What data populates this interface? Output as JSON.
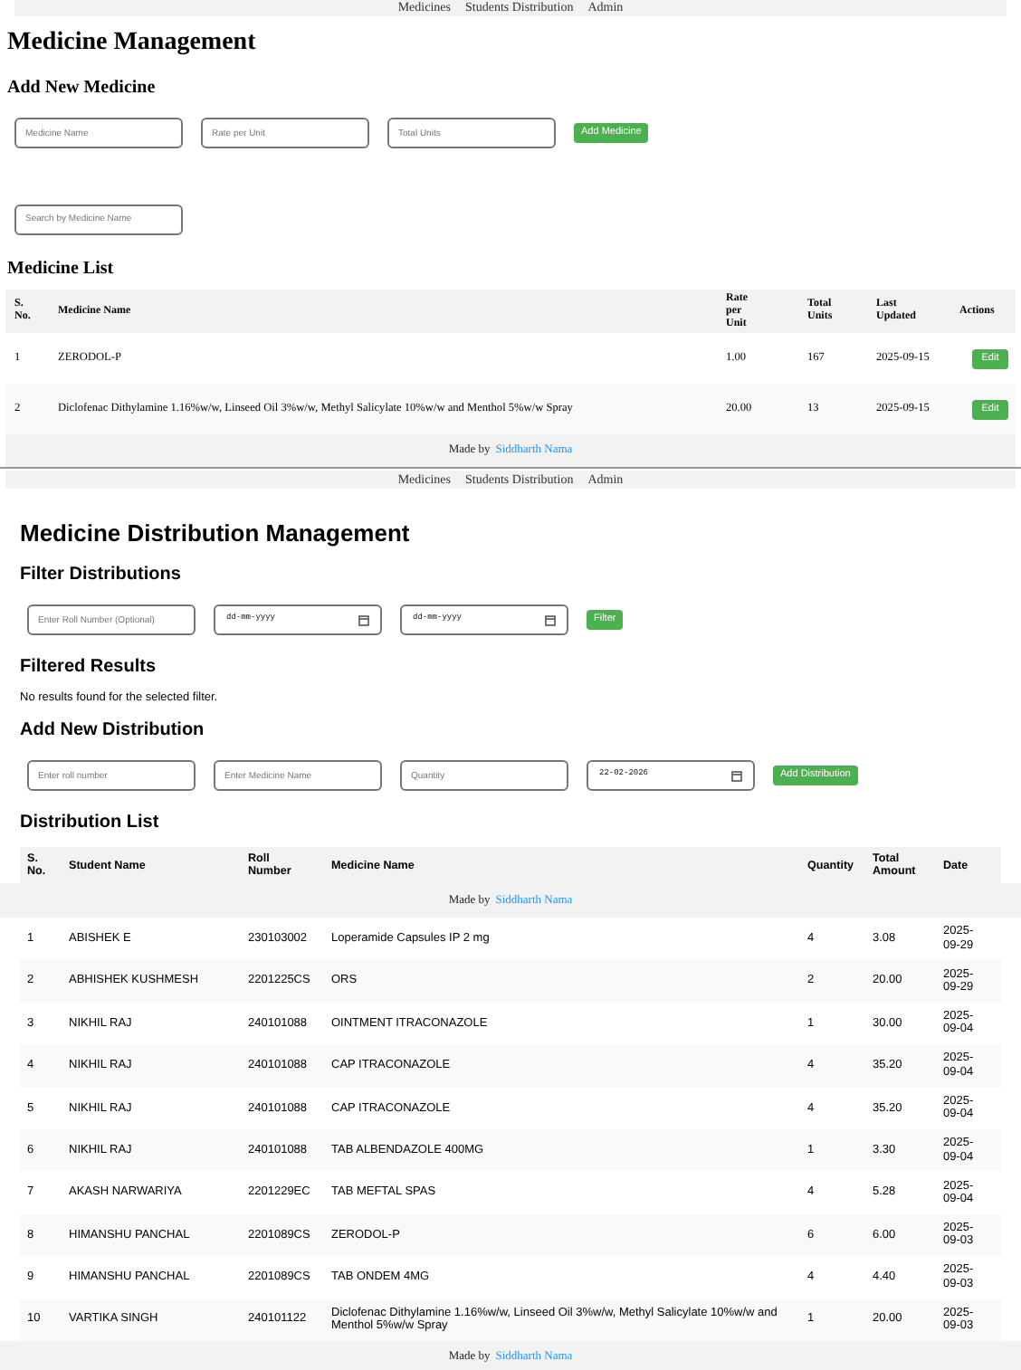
{
  "top_nav": {
    "items": [
      "Medicines",
      "Students Distribution",
      "Admin"
    ]
  },
  "medicine_page": {
    "title": "Medicine Management",
    "add_heading": "Add New Medicine",
    "fields": [
      {
        "kind": "text",
        "placeholder": "Medicine Name"
      },
      {
        "kind": "text",
        "placeholder": "Rate per Unit"
      },
      {
        "kind": "text",
        "placeholder": "Total Units"
      }
    ],
    "add_button": "Add Medicine",
    "search": {
      "placeholder": "Search by Medicine Name"
    },
    "list_heading": "Medicine List",
    "table": {
      "columns": [
        "S. No.",
        "Medicine Name",
        "Rate per Unit",
        "Total Units",
        "Last Updated",
        "Actions"
      ],
      "rows": [
        {
          "cells": [
            "1",
            "ZERODOL-P",
            "1.00",
            "167",
            "2025-09-15"
          ],
          "action": "Edit"
        },
        {
          "cells": [
            "2",
            "Diclofenac Dithylamine 1.16%w/w, Linseed Oil 3%w/w, Methyl Salicylate 10%w/w and Menthol 5%w/w Spray",
            "20.00",
            "13",
            "2025-09-15"
          ],
          "action": "Edit"
        }
      ]
    },
    "footer": {
      "prefix": "Made by",
      "link": "Siddharth Nama"
    }
  },
  "nav": {
    "items": [
      "Medicines",
      "Students Distribution",
      "Admin"
    ]
  },
  "distribution_page": {
    "title": "Medicine Distribution Management",
    "filter_heading": "Filter Distributions",
    "filter_fields": [
      {
        "kind": "text",
        "placeholder": "Enter Roll Number (Optional)"
      },
      {
        "kind": "date",
        "value": "dd-mm-yyyy"
      },
      {
        "kind": "date",
        "value": "dd-mm-yyyy"
      }
    ],
    "filter_button": "Filter",
    "results_heading": "Filtered Results",
    "results_message": "No results found for the selected filter.",
    "add_heading": "Add New Distribution",
    "add_fields": [
      {
        "kind": "text",
        "placeholder": "Enter roll number"
      },
      {
        "kind": "text",
        "placeholder": "Enter Medicine Name"
      },
      {
        "kind": "text",
        "placeholder": "Quantity"
      },
      {
        "kind": "date",
        "value": "22-02-2026"
      }
    ],
    "add_button": "Add Distribution",
    "list_heading": "Distribution List",
    "table": {
      "columns": [
        "S. No.",
        "Student Name",
        "Roll Number",
        "Medicine Name",
        "Quantity",
        "Total Amount",
        "Date"
      ],
      "rows": [
        [
          "1",
          "ABISHEK E",
          "230103002",
          "Loperamide Capsules IP 2 mg",
          "4",
          "3.08",
          "2025-09-29"
        ],
        [
          "2",
          "ABHISHEK KUSHMESH",
          "2201225CS",
          "ORS",
          "2",
          "20.00",
          "2025-09-29"
        ],
        [
          "3",
          "NIKHIL RAJ",
          "240101088",
          "OINTMENT ITRACONAZOLE",
          "1",
          "30.00",
          "2025-09-04"
        ],
        [
          "4",
          "NIKHIL RAJ",
          "240101088",
          "CAP ITRACONAZOLE",
          "4",
          "35.20",
          "2025-09-04"
        ],
        [
          "5",
          "NIKHIL RAJ",
          "240101088",
          "CAP ITRACONAZOLE",
          "4",
          "35.20",
          "2025-09-04"
        ],
        [
          "6",
          "NIKHIL RAJ",
          "240101088",
          "TAB ALBENDAZOLE 400MG",
          "1",
          "3.30",
          "2025-09-04"
        ],
        [
          "7",
          "AKASH NARWARIYA",
          "2201229EC",
          "TAB MEFTAL SPAS",
          "4",
          "5.28",
          "2025-09-04"
        ],
        [
          "8",
          "HIMANSHU PANCHAL",
          "2201089CS",
          "ZERODOL-P",
          "6",
          "6.00",
          "2025-09-03"
        ],
        [
          "9",
          "HIMANSHU PANCHAL",
          "2201089CS",
          "TAB ONDEM 4MG",
          "4",
          "4.40",
          "2025-09-03"
        ],
        [
          "10",
          "VARTIKA SINGH",
          "240101122",
          "Diclofenac Dithylamine 1.16%w/w, Linseed Oil 3%w/w, Methyl Salicylate 10%w/w and Menthol 5%w/w Spray",
          "1",
          "20.00",
          "2025-09-03"
        ]
      ]
    },
    "overlay_footer": {
      "prefix": "Made by",
      "link": "Siddharth Nama"
    },
    "footer": {
      "prefix": "Made by",
      "link": "Siddharth Nama"
    }
  }
}
